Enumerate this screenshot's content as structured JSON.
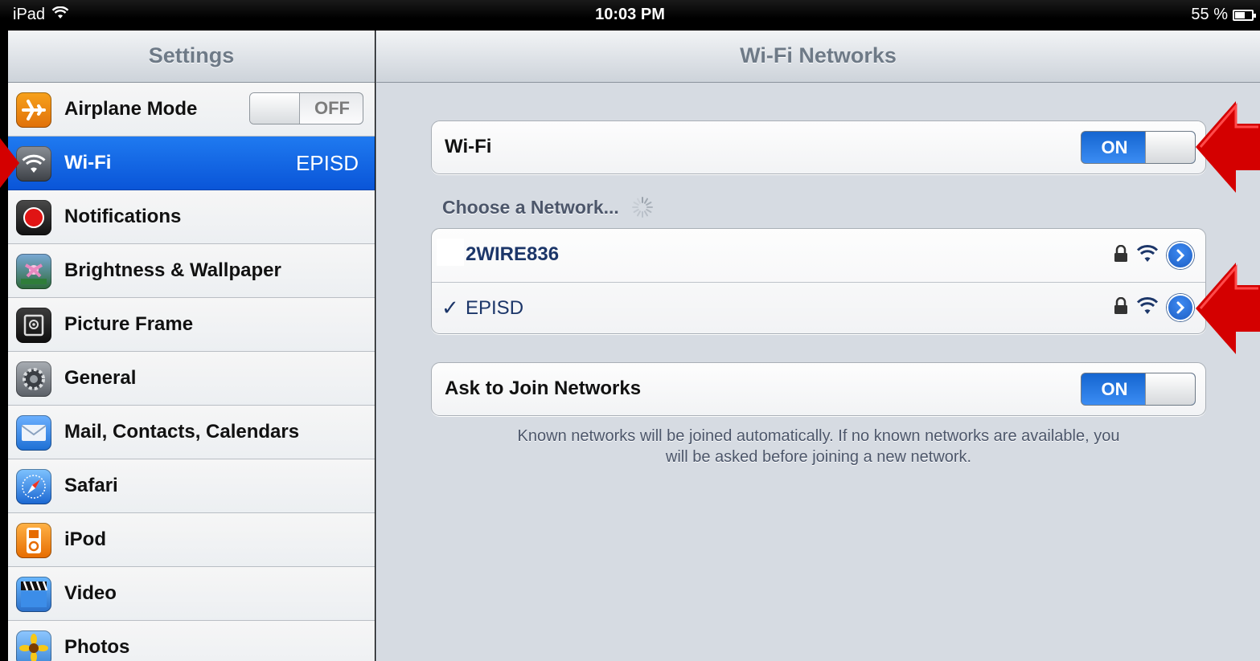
{
  "status_bar": {
    "device": "iPad",
    "time": "10:03 PM",
    "battery": "55 %"
  },
  "sidebar": {
    "title": "Settings",
    "items": [
      {
        "label": "Airplane Mode",
        "toggle": "OFF",
        "icon": "airplane-icon"
      },
      {
        "label": "Wi-Fi",
        "value": "EPISD",
        "icon": "wifi-icon",
        "selected": true
      },
      {
        "label": "Notifications",
        "icon": "notifications-icon"
      },
      {
        "label": "Brightness & Wallpaper",
        "icon": "brightness-wallpaper-icon"
      },
      {
        "label": "Picture Frame",
        "icon": "picture-frame-icon"
      },
      {
        "label": "General",
        "icon": "gear-icon"
      },
      {
        "label": "Mail, Contacts, Calendars",
        "icon": "mail-icon"
      },
      {
        "label": "Safari",
        "icon": "safari-compass-icon"
      },
      {
        "label": "iPod",
        "icon": "ipod-icon"
      },
      {
        "label": "Video",
        "icon": "video-clapper-icon"
      },
      {
        "label": "Photos",
        "icon": "photos-sunflower-icon"
      }
    ]
  },
  "main": {
    "title": "Wi-Fi Networks",
    "wifi_label": "Wi-Fi",
    "wifi_toggle": "ON",
    "choose_label": "Choose a Network...",
    "networks": [
      {
        "name": "2WIRE836",
        "connected": false,
        "locked": true
      },
      {
        "name": "EPISD",
        "connected": true,
        "check": "✓",
        "locked": true
      }
    ],
    "ask_label": "Ask to Join Networks",
    "ask_toggle": "ON",
    "footnote_line1": "Known networks will be joined automatically.  If no known networks are available, you",
    "footnote_line2": "will be asked before joining a new network."
  },
  "colors": {
    "selected_row": "#0a55d8",
    "toggle_on": "#1565d0",
    "annotation_arrow": "#d40000"
  }
}
